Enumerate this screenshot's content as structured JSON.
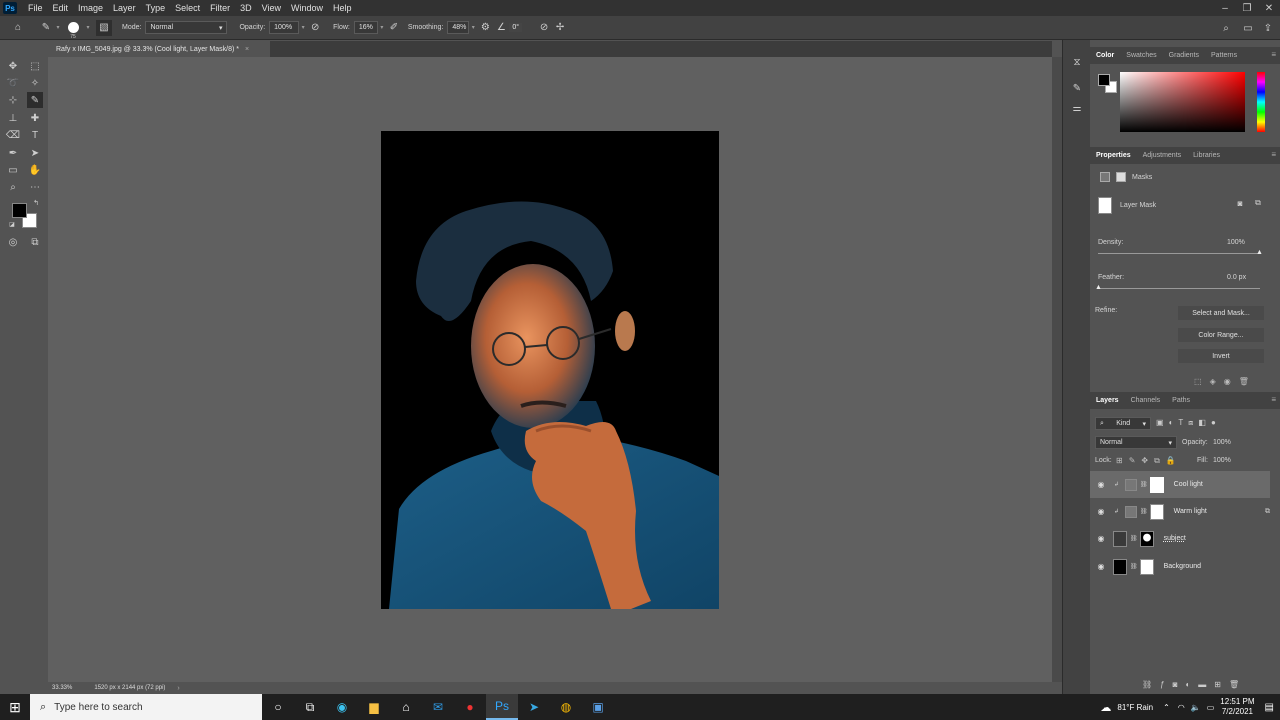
{
  "menubar": {
    "logo": "Ps",
    "items": [
      "File",
      "Edit",
      "Image",
      "Layer",
      "Type",
      "Select",
      "Filter",
      "3D",
      "View",
      "Window",
      "Help"
    ]
  },
  "options": {
    "brush_size": "75",
    "mode_label": "Mode:",
    "mode_value": "Normal",
    "opacity_label": "Opacity:",
    "opacity_value": "100%",
    "flow_label": "Flow:",
    "flow_value": "16%",
    "smoothing_label": "Smoothing:",
    "smoothing_value": "48%",
    "angle_value": "0°"
  },
  "document": {
    "tab_title": "Rafy x IMG_5049.jpg @ 33.3% (Cool light, Layer Mask/8) *",
    "zoom": "33.33%",
    "info": "1520 px x 2144 px (72 ppi)"
  },
  "color_panel": {
    "tabs": [
      "Color",
      "Swatches",
      "Gradients",
      "Patterns"
    ],
    "hue_hex": "#ff0000"
  },
  "properties": {
    "tabs": [
      "Properties",
      "Adjustments",
      "Libraries"
    ],
    "masks_label": "Masks",
    "layer_mask_label": "Layer Mask",
    "density_label": "Density:",
    "density_value": "100%",
    "feather_label": "Feather:",
    "feather_value": "0.0 px",
    "refine_label": "Refine:",
    "select_and_mask": "Select and Mask...",
    "color_range": "Color Range...",
    "invert": "Invert"
  },
  "layers": {
    "tabs": [
      "Layers",
      "Channels",
      "Paths"
    ],
    "filter_kind": "Kind",
    "blend_mode": "Normal",
    "opacity_label": "Opacity:",
    "opacity_value": "100%",
    "lock_label": "Lock:",
    "fill_label": "Fill:",
    "fill_value": "100%",
    "items": [
      {
        "name": "Cool light",
        "selected": true
      },
      {
        "name": "Warm light",
        "selected": false
      },
      {
        "name": "subject",
        "selected": false
      },
      {
        "name": "Background",
        "selected": false
      }
    ]
  },
  "taskbar": {
    "search_placeholder": "Type here to search",
    "weather": "81°F  Rain",
    "time": "12:51 PM",
    "date": "7/2/2021"
  }
}
